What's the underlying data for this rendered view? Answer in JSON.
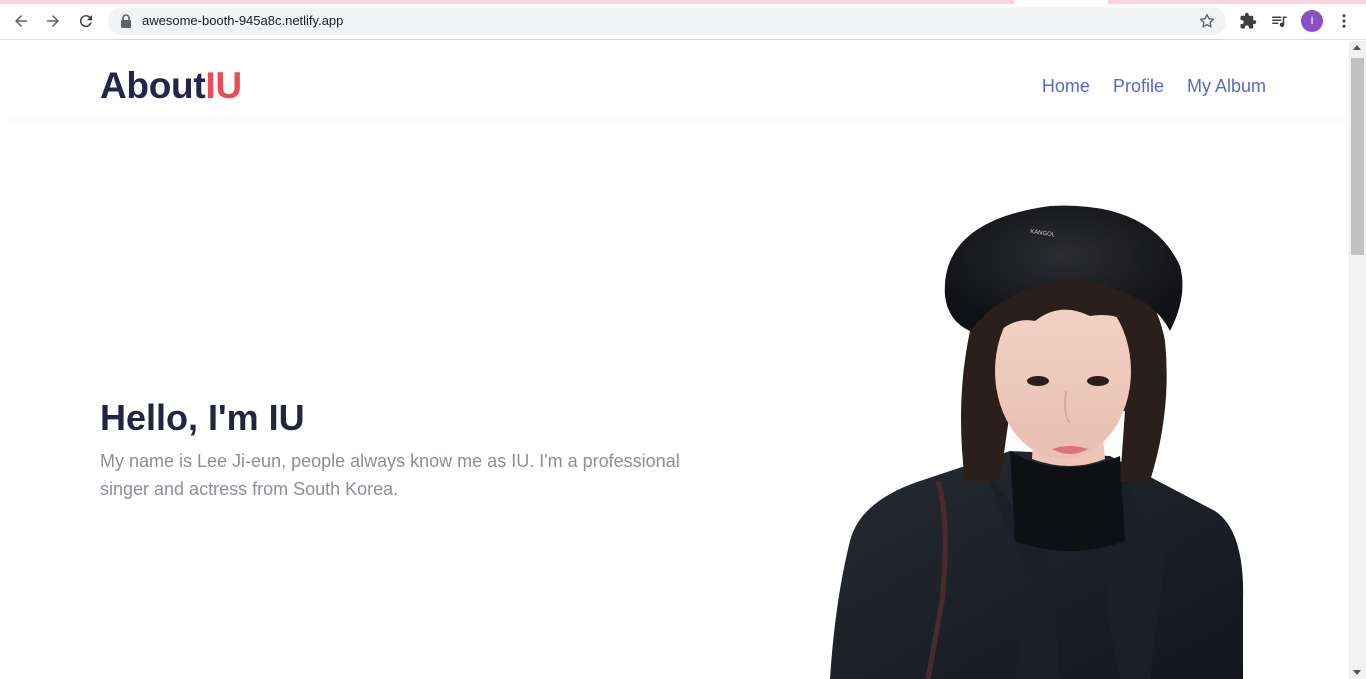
{
  "browser": {
    "url": "awesome-booth-945a8c.netlify.app",
    "profile_initial": "I",
    "accent_color": "#f9d3dd"
  },
  "site": {
    "logo_main": "About",
    "logo_accent": "IU",
    "logo_color": "#23264a",
    "accent_color": "#ec4a57",
    "nav": [
      {
        "label": "Home"
      },
      {
        "label": "Profile"
      },
      {
        "label": "My Album"
      }
    ],
    "nav_color": "#5a68c9"
  },
  "hero": {
    "title": "Hello, I'm IU",
    "description": "My name is Lee Ji-eun, people always know me as IU. I'm a professional singer and actress from South Korea."
  },
  "portrait": {
    "hat_label": "KANGOL"
  }
}
